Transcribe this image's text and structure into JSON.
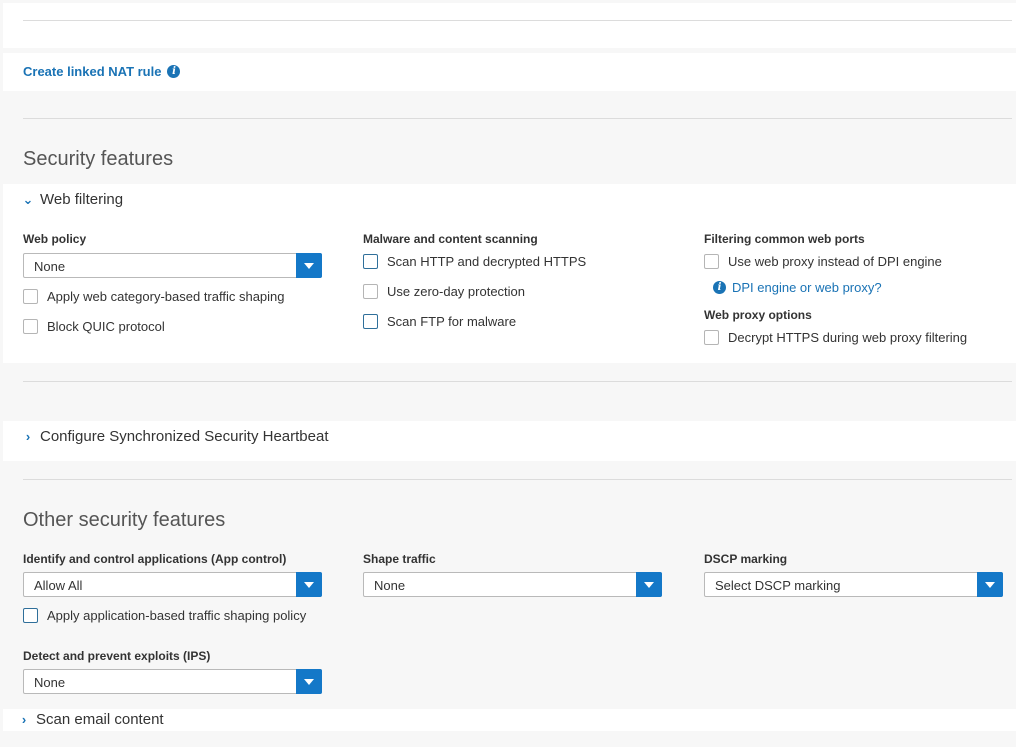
{
  "nat": {
    "link_label": "Create linked NAT rule"
  },
  "security": {
    "title": "Security features",
    "web_filtering": {
      "heading": "Web filtering",
      "web_policy": {
        "label": "Web policy",
        "value": "None"
      },
      "apply_shaping_label": "Apply web category-based traffic shaping",
      "block_quic_label": "Block QUIC protocol",
      "malware": {
        "heading": "Malware and content scanning",
        "scan_http_label": "Scan HTTP and decrypted HTTPS",
        "zero_day_label": "Use zero-day protection",
        "scan_ftp_label": "Scan FTP for malware"
      },
      "ports": {
        "heading": "Filtering common web ports",
        "use_proxy_label": "Use web proxy instead of DPI engine",
        "help_link": "DPI engine or web proxy?"
      },
      "proxy_options": {
        "heading": "Web proxy options",
        "decrypt_label": "Decrypt HTTPS during web proxy filtering"
      }
    },
    "heartbeat_heading": "Configure Synchronized Security Heartbeat"
  },
  "other": {
    "title": "Other security features",
    "app_control": {
      "label": "Identify and control applications (App control)",
      "value": "Allow All"
    },
    "app_shaping_label": "Apply application-based traffic shaping policy",
    "shape_traffic": {
      "label": "Shape traffic",
      "value": "None"
    },
    "dscp": {
      "label": "DSCP marking",
      "value": "Select DSCP marking"
    },
    "ips": {
      "label": "Detect and prevent exploits (IPS)",
      "value": "None"
    },
    "scan_email_heading": "Scan email content"
  },
  "colors": {
    "accent": "#1478c8",
    "link": "#1a73b5",
    "panel": "#ffffff",
    "background": "#f7f7f7"
  },
  "icons": [
    "info-icon",
    "chevron-down-icon",
    "chevron-right-icon",
    "dropdown-arrow-icon"
  ]
}
